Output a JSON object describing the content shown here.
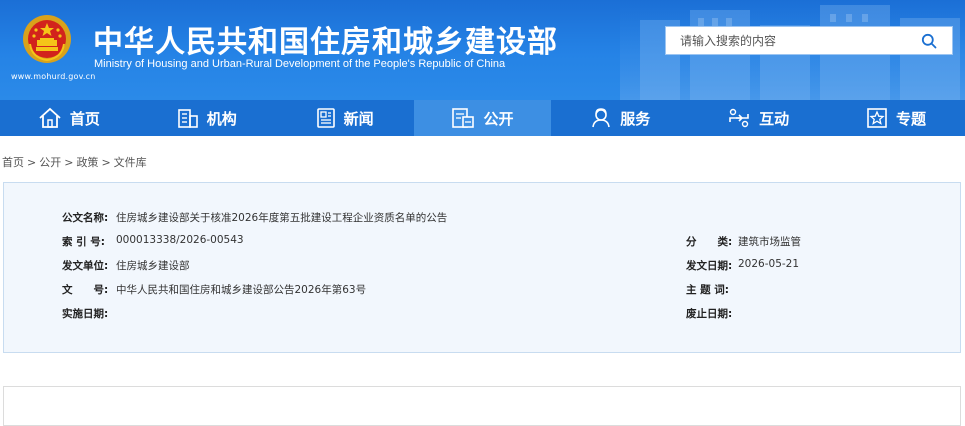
{
  "header": {
    "site_url": "www.mohurd.gov.cn",
    "title_cn": "中华人民共和国住房和城乡建设部",
    "title_en": "Ministry of Housing and Urban-Rural Development of the People's Republic of China",
    "search_placeholder": "请输入搜索的内容"
  },
  "nav": [
    {
      "label": "首页",
      "icon": "home-icon"
    },
    {
      "label": "机构",
      "icon": "building-icon"
    },
    {
      "label": "新闻",
      "icon": "news-icon"
    },
    {
      "label": "公开",
      "icon": "document-icon",
      "active": true
    },
    {
      "label": "服务",
      "icon": "person-service-icon"
    },
    {
      "label": "互动",
      "icon": "interaction-icon"
    },
    {
      "label": "专题",
      "icon": "star-topic-icon"
    }
  ],
  "breadcrumb": [
    "首页",
    "公开",
    "政策",
    "文件库"
  ],
  "doc": {
    "name_label": "公文名称:",
    "name_value": "住房城乡建设部关于核准2026年度第五批建设工程企业资质名单的公告",
    "index_label": "索 引 号:",
    "index_value": "000013338/2026-00543",
    "category_label": "分　　类:",
    "category_value": "建筑市场监管",
    "issuer_label": "发文单位:",
    "issuer_value": "住房城乡建设部",
    "date_label": "发文日期:",
    "date_value": "2026-05-21",
    "docno_label": "文　　号:",
    "docno_value": "中华人民共和国住房和城乡建设部公告2026年第63号",
    "subject_label": "主 题 词:",
    "subject_value": "",
    "effective_label": "实施日期:",
    "effective_value": "",
    "repeal_label": "废止日期:",
    "repeal_value": ""
  },
  "colors": {
    "header_blue": "#2583e6",
    "nav_blue": "#1a6fd1",
    "nav_active": "#3d8fe3",
    "info_bg": "#f2f7fd"
  }
}
